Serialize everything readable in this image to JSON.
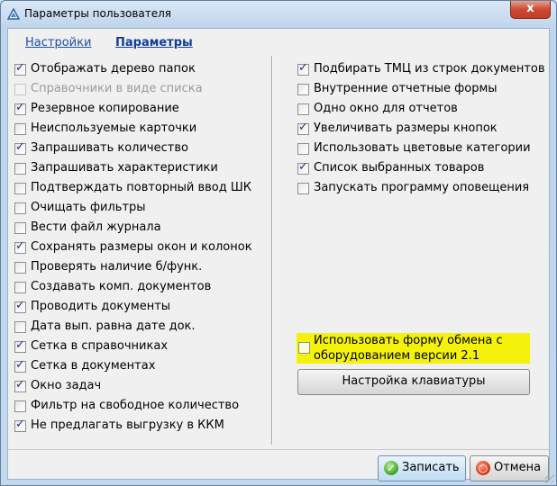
{
  "window": {
    "title": "Параметры пользователя",
    "close_label": "x"
  },
  "tabs": [
    {
      "label": "Настройки",
      "active": false
    },
    {
      "label": "Параметры",
      "active": true
    }
  ],
  "left_options": [
    {
      "label": "Отображать дерево папок",
      "checked": true,
      "disabled": false
    },
    {
      "label": "Справочники в виде списка",
      "checked": false,
      "disabled": true
    },
    {
      "label": "Резервное копирование",
      "checked": true,
      "disabled": false
    },
    {
      "label": "Неиспользуемые карточки",
      "checked": false,
      "disabled": false
    },
    {
      "label": "Запрашивать количество",
      "checked": true,
      "disabled": false
    },
    {
      "label": "Запрашивать характеристики",
      "checked": false,
      "disabled": false
    },
    {
      "label": "Подтверждать повторный ввод ШК",
      "checked": false,
      "disabled": false
    },
    {
      "label": "Очищать фильтры",
      "checked": false,
      "disabled": false
    },
    {
      "label": "Вести файл журнала",
      "checked": false,
      "disabled": false
    },
    {
      "label": "Сохранять размеры окон и колонок",
      "checked": true,
      "disabled": false
    },
    {
      "label": "Проверять наличие б/функ.",
      "checked": false,
      "disabled": false
    },
    {
      "label": "Создавать комп. документов",
      "checked": false,
      "disabled": false
    },
    {
      "label": "Проводить документы",
      "checked": true,
      "disabled": false
    },
    {
      "label": "Дата вып. равна дате док.",
      "checked": false,
      "disabled": false
    },
    {
      "label": "Сетка в справочниках",
      "checked": true,
      "disabled": false
    },
    {
      "label": "Сетка в документах",
      "checked": true,
      "disabled": false
    },
    {
      "label": "Окно задач",
      "checked": true,
      "disabled": false
    },
    {
      "label": "Фильтр на свободное количество",
      "checked": false,
      "disabled": false
    },
    {
      "label": "Не предлагать выгрузку в ККМ",
      "checked": true,
      "disabled": false
    }
  ],
  "right_options": [
    {
      "label": "Подбирать ТМЦ из строк документов",
      "checked": true
    },
    {
      "label": "Внутренние отчетные формы",
      "checked": false
    },
    {
      "label": "Одно окно для отчетов",
      "checked": false
    },
    {
      "label": "Увеличивать размеры кнопок",
      "checked": true
    },
    {
      "label": "Использовать цветовые категории",
      "checked": false
    },
    {
      "label": "Список выбранных товаров",
      "checked": true
    },
    {
      "label": "Запускать программу оповещения",
      "checked": false
    }
  ],
  "exchange_form": {
    "label": "Использовать форму обмена с оборудованием версии 2.1",
    "checked": false,
    "highlight_color": "#f4f20b"
  },
  "keyboard_button": {
    "label": "Настройка клавиатуры"
  },
  "footer": {
    "save_label": "Записать",
    "cancel_label": "Отмена",
    "save_icon": "check-circle-icon",
    "cancel_icon": "cancel-circle-icon"
  }
}
